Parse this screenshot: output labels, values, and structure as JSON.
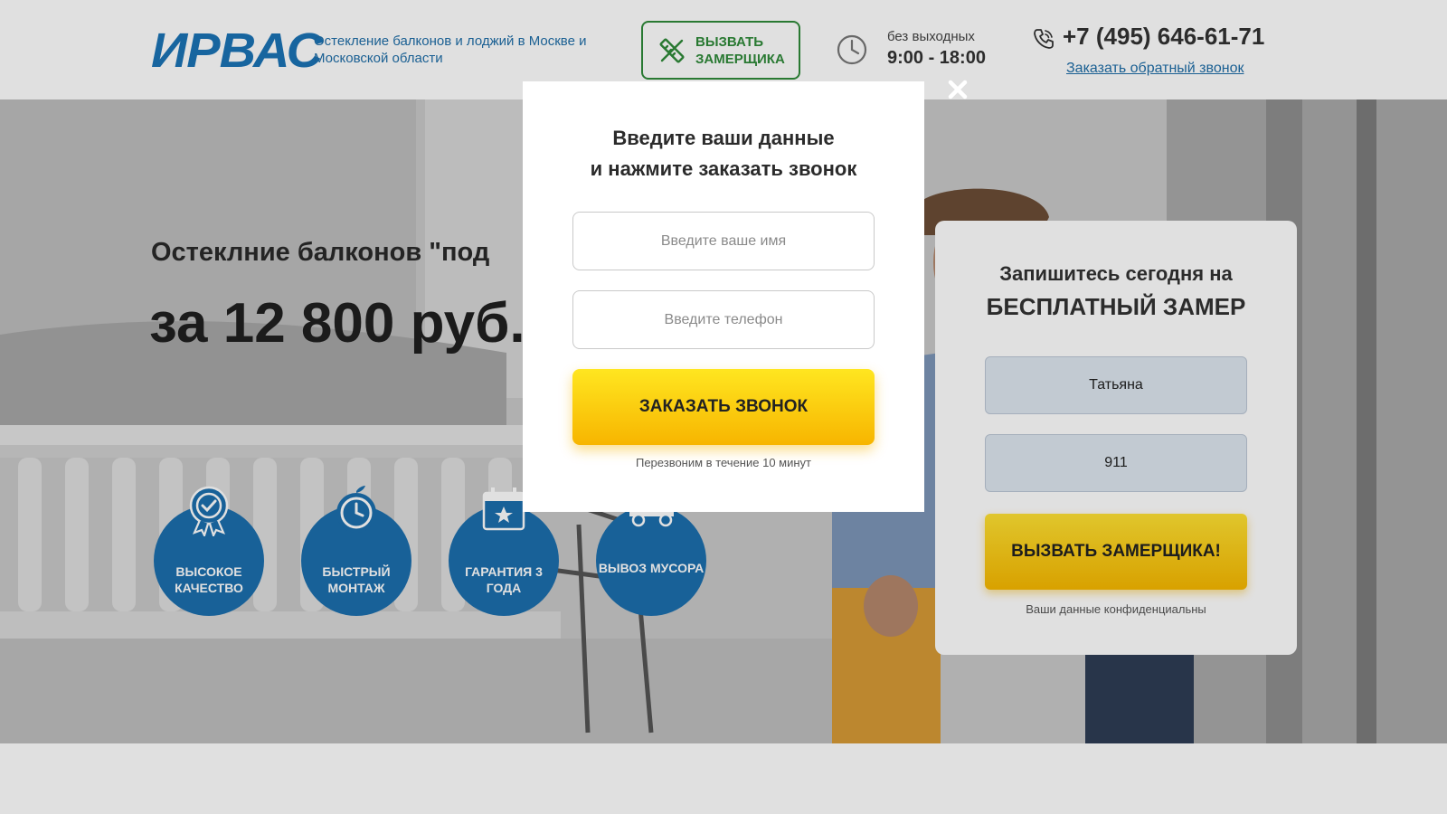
{
  "header": {
    "logo": "ИРВАС",
    "tagline": "Остекление балконов и лоджий в Москве и Московской области",
    "call_button": "ВЫЗВАТЬ ЗАМЕРЩИКА",
    "hours_label": "без выходных",
    "hours": "9:00 - 18:00",
    "phone": "+7 (495) 646-61-71",
    "callback_link": "Заказать обратный звонок"
  },
  "hero": {
    "subtitle": "Остеклние балконов \"под",
    "price": "за 12 800 руб."
  },
  "features": [
    {
      "label": "ВЫСОКОЕ КАЧЕСТВО",
      "icon": "quality-badge-icon"
    },
    {
      "label": "БЫСТРЫЙ МОНТАЖ",
      "icon": "stopwatch-icon"
    },
    {
      "label": "ГАРАНТИЯ 3 ГОДА",
      "icon": "calendar-icon"
    },
    {
      "label": "ВЫВОЗ МУСОРА",
      "icon": "truck-icon"
    }
  ],
  "signup_form": {
    "title_line1": "Запишитесь сегодня на",
    "title_line2": "БЕСПЛАТНЫЙ ЗАМЕР",
    "name_value": "Татьяна",
    "phone_value": "911",
    "button": "ВЫЗВАТЬ ЗАМЕРЩИКА!",
    "note": "Ваши данные конфиденциальны"
  },
  "modal": {
    "title_line1": "Введите ваши данные",
    "title_line2": "и нажмите заказать звонок",
    "name_placeholder": "Введите ваше имя",
    "phone_placeholder": "Введите телефон",
    "submit": "ЗАКАЗАТЬ ЗВОНОК",
    "hint": "Перезвоним в течение 10 минут"
  },
  "colors": {
    "brand_blue": "#1b73b6",
    "green": "#2f8a3a",
    "cta_yellow": "#f7b800"
  }
}
